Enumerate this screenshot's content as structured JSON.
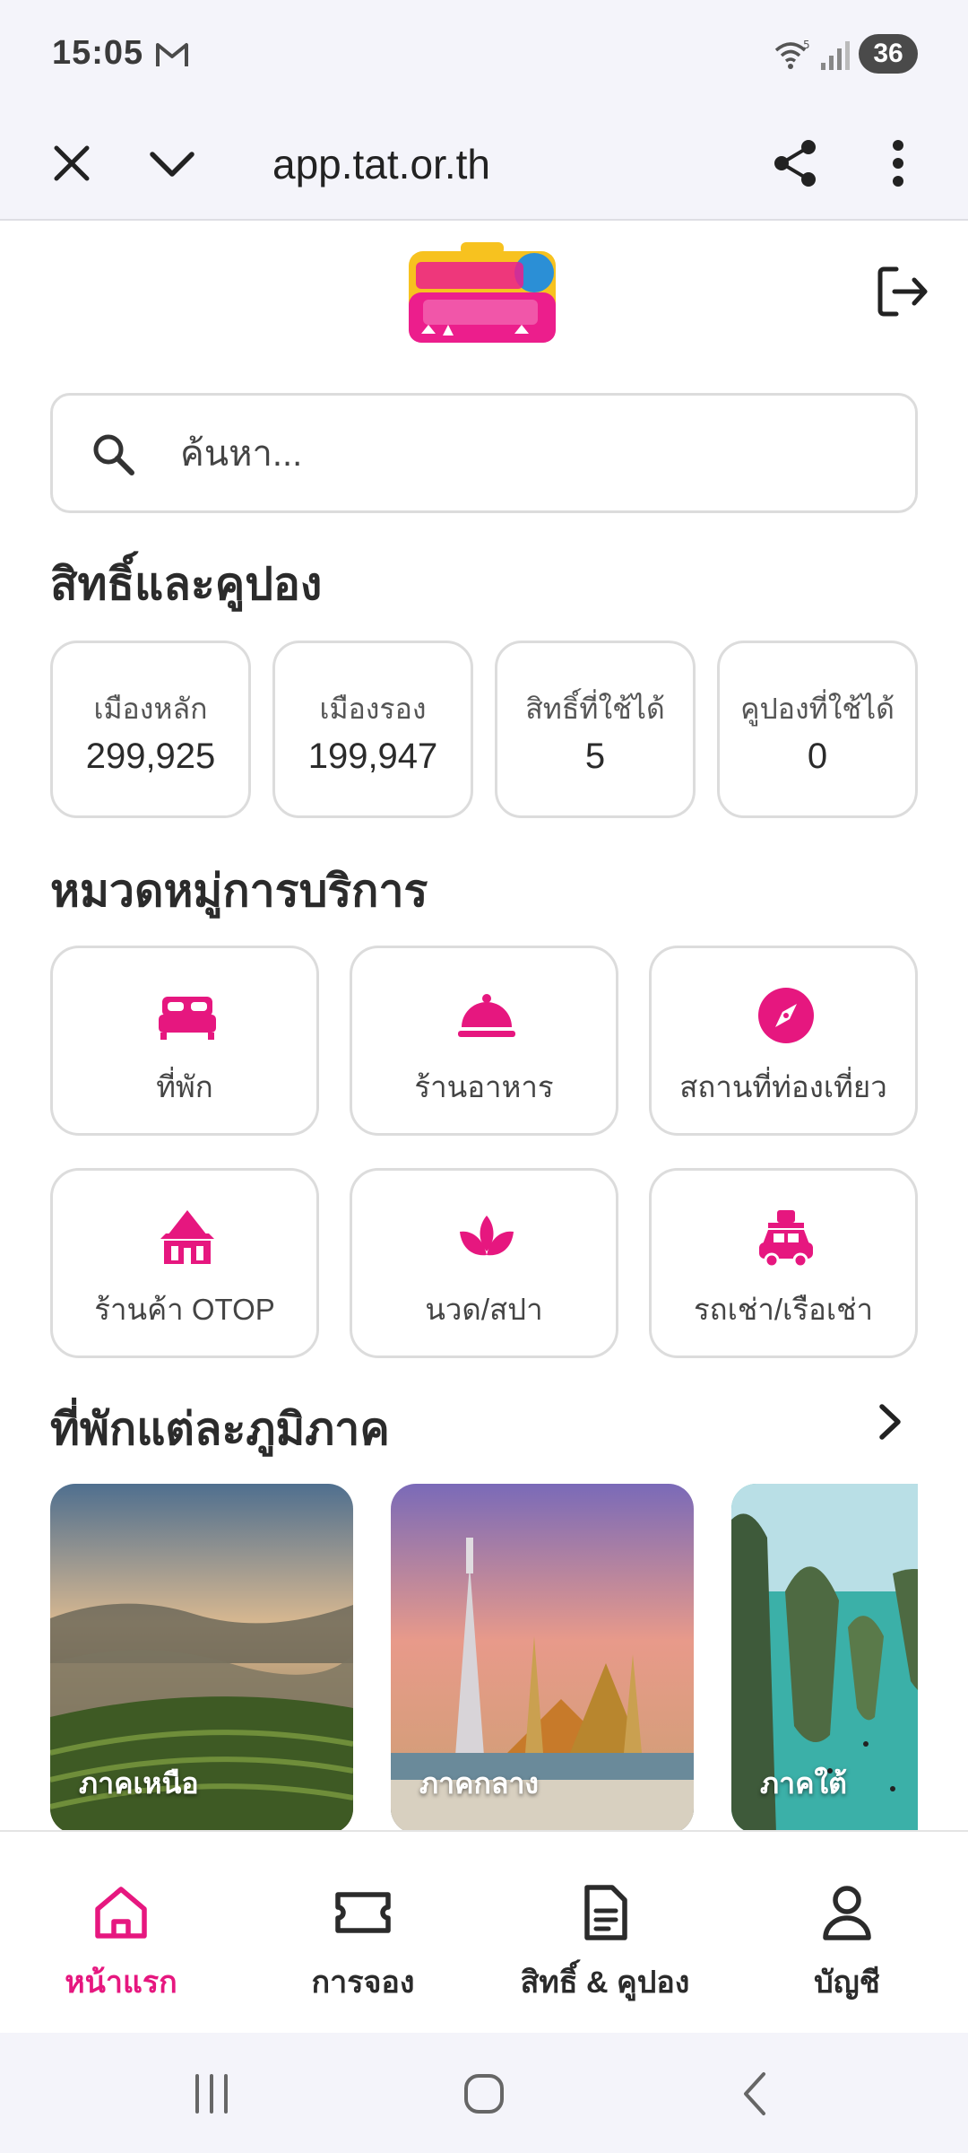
{
  "status_bar": {
    "time": "15:05",
    "battery": "36"
  },
  "browser": {
    "url": "app.tat.or.th"
  },
  "search": {
    "placeholder": "ค้นหา..."
  },
  "rights": {
    "title": "สิทธิ์และคูปอง",
    "cards": [
      {
        "label": "เมืองหลัก",
        "value": "299,925"
      },
      {
        "label": "เมืองรอง",
        "value": "199,947"
      },
      {
        "label": "สิทธิ์ที่ใช้ได้",
        "value": "5"
      },
      {
        "label": "คูปองที่ใช้ได้",
        "value": "0"
      }
    ]
  },
  "categories": {
    "title": "หมวดหมู่การบริการ",
    "items": [
      {
        "label": "ที่พัก",
        "icon": "bed-icon"
      },
      {
        "label": "ร้านอาหาร",
        "icon": "food-cloche-icon"
      },
      {
        "label": "สถานที่ท่องเที่ยว",
        "icon": "compass-icon"
      },
      {
        "label": "ร้านค้า OTOP",
        "icon": "thai-pavilion-icon"
      },
      {
        "label": "นวด/สปา",
        "icon": "lotus-icon"
      },
      {
        "label": "รถเช่า/เรือเช่า",
        "icon": "car-luggage-icon"
      }
    ]
  },
  "regions": {
    "title": "ที่พักแต่ละภูมิภาค",
    "items": [
      {
        "label": "ภาคเหนือ"
      },
      {
        "label": "ภาคกลาง"
      },
      {
        "label": "ภาคใต้"
      }
    ]
  },
  "bottom_nav": {
    "items": [
      {
        "label": "หน้าแรก",
        "icon": "home-icon",
        "active": true
      },
      {
        "label": "การจอง",
        "icon": "ticket-icon",
        "active": false
      },
      {
        "label": "สิทธิ์ & คูปอง",
        "icon": "document-icon",
        "active": false
      },
      {
        "label": "บัญชี",
        "icon": "user-icon",
        "active": false
      }
    ]
  },
  "colors": {
    "accent": "#e6177f",
    "border": "#dcdcdc",
    "text": "#2b2b2b",
    "chrome_bg": "#f4f4fa"
  }
}
